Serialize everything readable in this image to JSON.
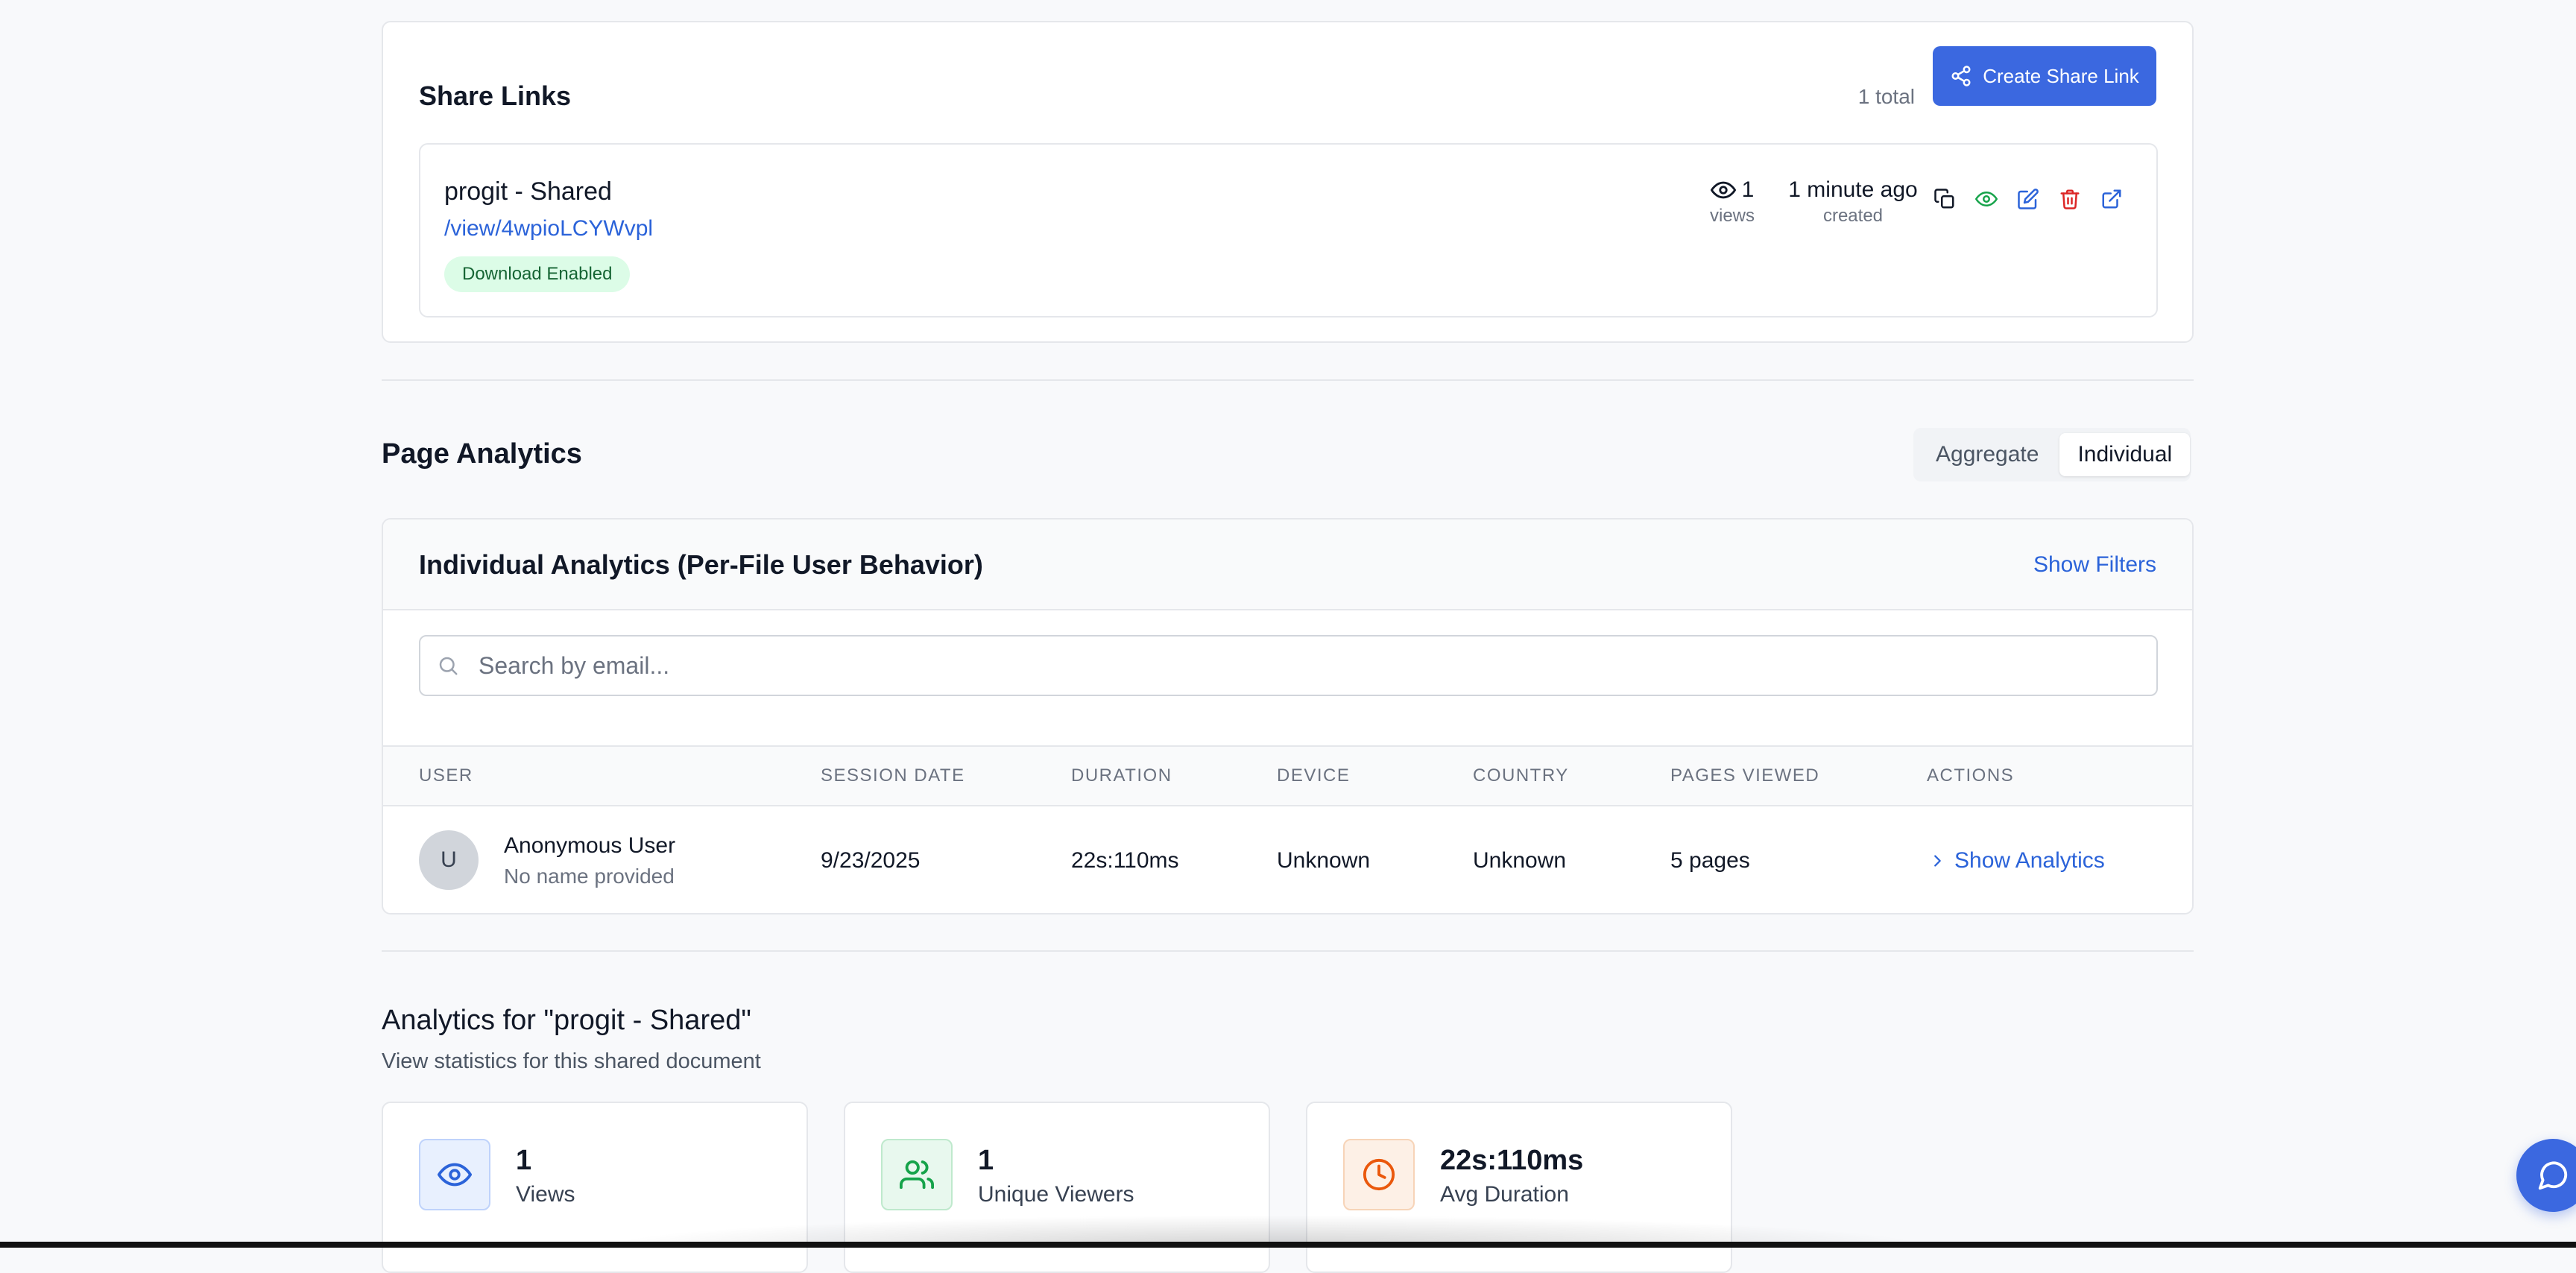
{
  "share_links": {
    "title": "Share Links",
    "total": "1 total",
    "create_button": "Create Share Link",
    "items": [
      {
        "name": "progit - Shared",
        "url": "/view/4wpioLCYWvpl",
        "badge": "Download Enabled",
        "views_count": "1",
        "views_label": "views",
        "created_value": "1 minute ago",
        "created_label": "created"
      }
    ]
  },
  "page_analytics": {
    "title": "Page Analytics",
    "toggle": {
      "aggregate": "Aggregate",
      "individual": "Individual",
      "selected": "Individual"
    }
  },
  "individual_analytics": {
    "title": "Individual Analytics (Per-File User Behavior)",
    "show_filters": "Show Filters",
    "search_placeholder": "Search by email...",
    "search_value": "",
    "columns": [
      "USER",
      "SESSION DATE",
      "DURATION",
      "DEVICE",
      "COUNTRY",
      "PAGES VIEWED",
      "ACTIONS"
    ],
    "rows": [
      {
        "avatar_initial": "U",
        "user_name": "Anonymous User",
        "user_sub": "No name provided",
        "session_date": "9/23/2025",
        "duration": "22s:110ms",
        "device": "Unknown",
        "country": "Unknown",
        "pages_viewed": "5 pages",
        "action": "Show Analytics"
      }
    ]
  },
  "analytics_for": {
    "title": "Analytics for \"progit - Shared\"",
    "subtitle": "View statistics for this shared document",
    "stats": [
      {
        "value": "1",
        "label": "Views",
        "icon": "eye-icon",
        "color": "#2b63d9",
        "bg": "#e8f0fe",
        "border": "#bfd3fb"
      },
      {
        "value": "1",
        "label": "Unique Viewers",
        "icon": "users-icon",
        "color": "#16a34a",
        "bg": "#e8f8ee",
        "border": "#bfe9cd"
      },
      {
        "value": "22s:110ms",
        "label": "Avg Duration",
        "icon": "clock-icon",
        "color": "#ea580c",
        "bg": "#fdf0e6",
        "border": "#f7d4b8"
      }
    ]
  },
  "colors": {
    "primary": "#3b68e0",
    "link": "#2b63d9",
    "success_bg": "#dcfce7",
    "success_text": "#166534",
    "danger": "#dc2626"
  }
}
